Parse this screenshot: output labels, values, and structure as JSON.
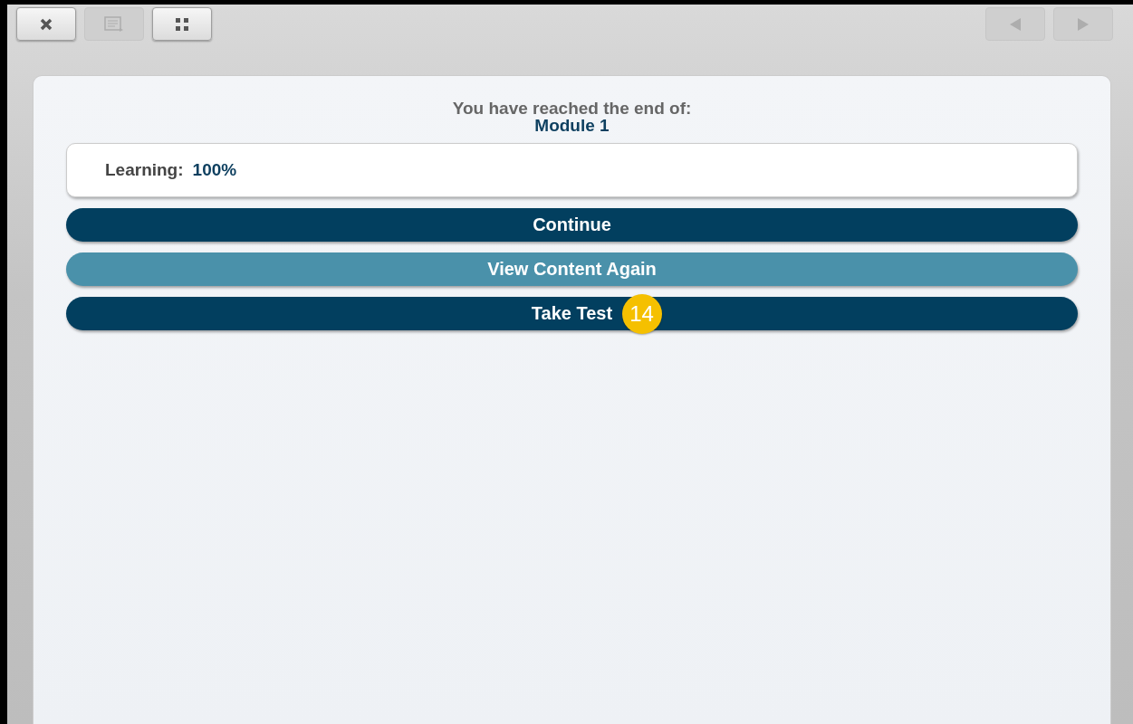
{
  "toolbar": {
    "left": [
      {
        "kind": "close",
        "disabled": false
      },
      {
        "kind": "notes",
        "disabled": true
      },
      {
        "kind": "menu",
        "disabled": false
      }
    ],
    "right": [
      {
        "kind": "prev",
        "disabled": true
      },
      {
        "kind": "next",
        "disabled": true
      }
    ]
  },
  "heading": {
    "intro": "You have reached the end of:",
    "module": "Module 1"
  },
  "progress": {
    "label": "Learning:",
    "value": "100%"
  },
  "actions": [
    {
      "label": "Continue",
      "kind": "primary"
    },
    {
      "label": "View Content Again",
      "kind": "secondary"
    },
    {
      "label": "Take Test",
      "kind": "primary",
      "badge": "14"
    }
  ]
}
